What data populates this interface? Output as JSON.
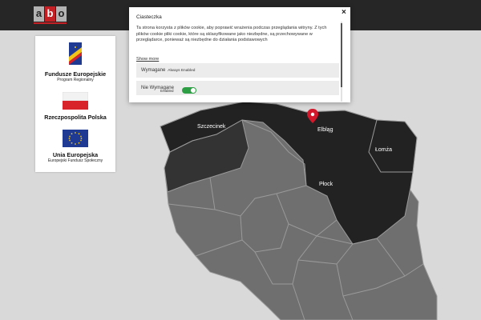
{
  "header": {
    "logo": {
      "letters": [
        "a",
        "b",
        "o"
      ]
    }
  },
  "funds_panel": {
    "items": [
      {
        "title": "Fundusze Europejskie",
        "subtitle": "Program Regionalny"
      },
      {
        "title": "Rzeczpospolita  Polska",
        "subtitle": ""
      },
      {
        "title": "Unia Europejska",
        "subtitle": "Europejski Fundusz Społeczny"
      }
    ]
  },
  "map": {
    "cities": [
      "Elbląg",
      "Szczecinek",
      "Łomża",
      "Płock"
    ],
    "colors": {
      "highlighted_region": "#222222",
      "region": "#6f6f6f",
      "border": "#9a9a9a",
      "marker": "#d3182b"
    }
  },
  "cookie_modal": {
    "title": "Ciasteczka",
    "close_icon": "×",
    "body": "Ta strona korzysta z plików cookie, aby poprawić wrażenia podczas przeglądania witryny. Z tych plików cookie pliki cookie, które są sklasyfikowane jako niezbędne, są przechowywane w przeglądarce, ponieważ są niezbędne do działania podstawowych",
    "show_more": "Show more",
    "categories": [
      {
        "label": "Wymagane",
        "state": "Always Enabled"
      },
      {
        "label": "Nie Wymagane",
        "toggle_label": "Enabled",
        "enabled": true
      }
    ]
  }
}
